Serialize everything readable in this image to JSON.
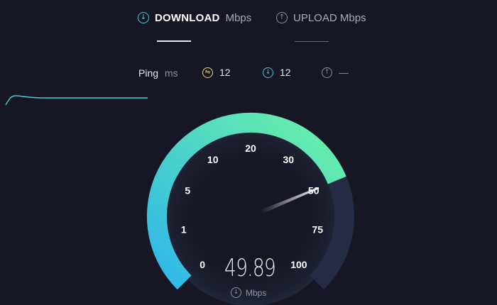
{
  "tabs": {
    "download": {
      "label": "DOWNLOAD",
      "unit": "Mbps",
      "active": true
    },
    "upload": {
      "label": "UPLOAD Mbps",
      "active": false
    }
  },
  "metrics": {
    "ping_label": "Ping",
    "ping_unit": "ms",
    "jitter": "12",
    "download_ping": "12",
    "upload_ping": "—"
  },
  "gauge": {
    "scale_labels": [
      "0",
      "1",
      "5",
      "10",
      "20",
      "30",
      "50",
      "75",
      "100"
    ],
    "current_value": 49.89,
    "fill_color_start": "#2fb6ea",
    "fill_color_end": "#6cf2a6",
    "track_color": "#252b45"
  },
  "result": {
    "speed": "49.89",
    "unit": "Mbps"
  },
  "colors": {
    "background": "#161625",
    "accent": "#3fd0d4"
  },
  "icons": {
    "download": "download-arrow-icon",
    "upload": "upload-arrow-icon",
    "jitter": "jitter-icon"
  }
}
